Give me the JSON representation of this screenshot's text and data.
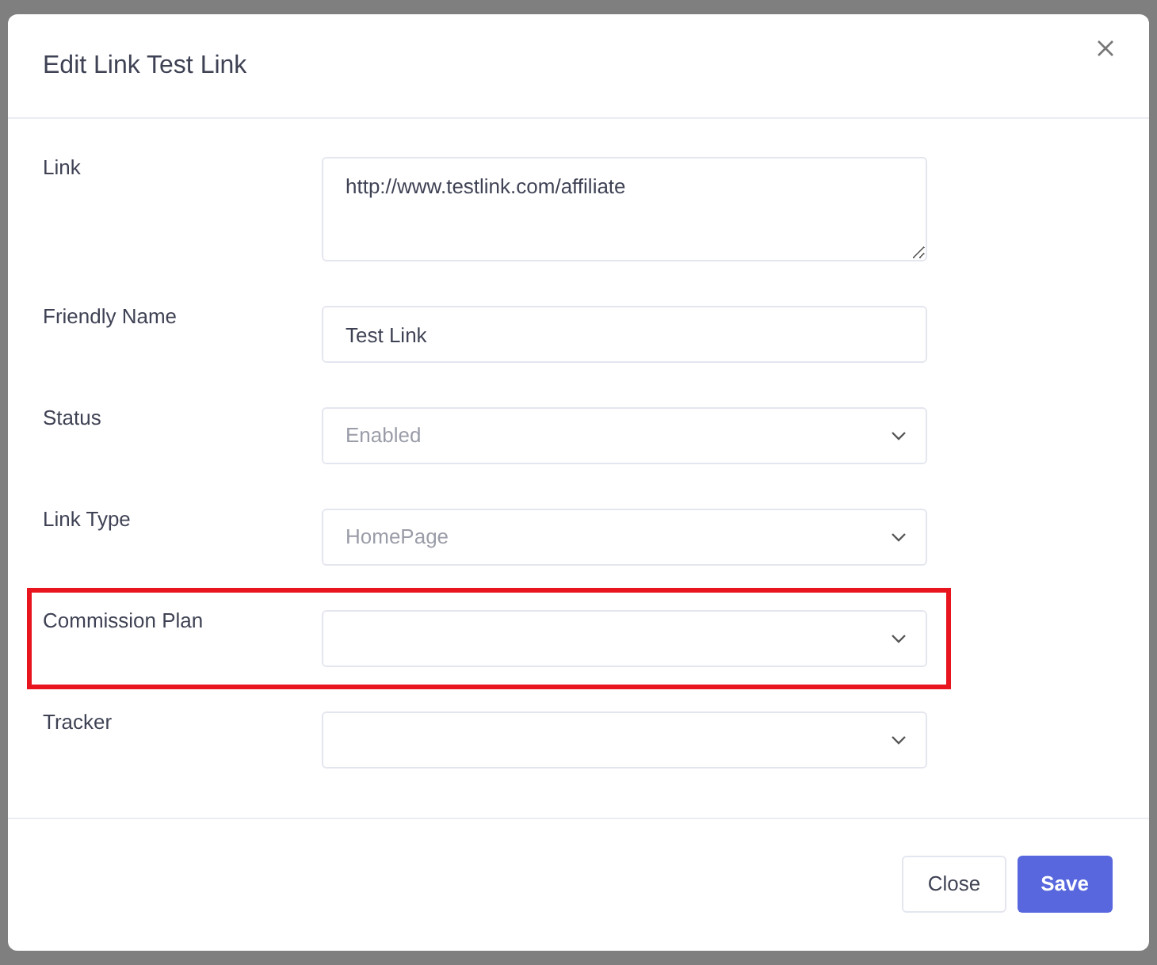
{
  "dialog": {
    "title": "Edit Link Test Link"
  },
  "fields": [
    {
      "kind": "textarea",
      "label": "Link",
      "value": "http://www.testlink.com/affiliate",
      "highlighted": false
    },
    {
      "kind": "text",
      "label": "Friendly Name",
      "value": "Test Link",
      "highlighted": false
    },
    {
      "kind": "select",
      "label": "Status",
      "value": "Enabled",
      "highlighted": false
    },
    {
      "kind": "select",
      "label": "Link Type",
      "value": "HomePage",
      "highlighted": false
    },
    {
      "kind": "select",
      "label": "Commission Plan",
      "highlighted": true
    },
    {
      "kind": "select",
      "label": "Tracker",
      "highlighted": false
    }
  ],
  "buttons": [
    {
      "label": "Close",
      "kind": "secondary"
    },
    {
      "label": "Save",
      "kind": "primary"
    }
  ]
}
